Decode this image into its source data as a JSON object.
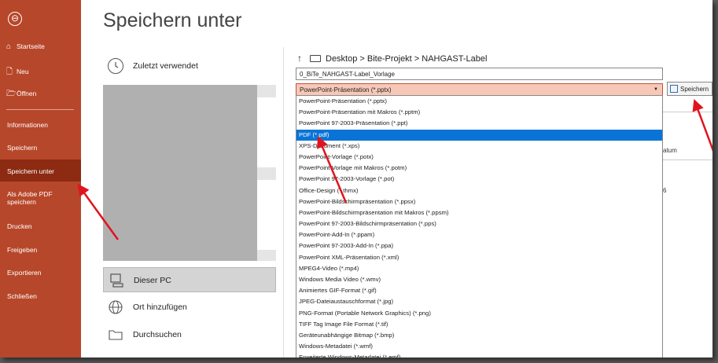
{
  "sidebar": {
    "back_symbol": "⊖",
    "items": [
      {
        "label": "Startseite",
        "icon": "home-icon"
      },
      {
        "label": "Neu",
        "icon": "new-document-icon"
      },
      {
        "label": "Öffnen",
        "icon": "open-folder-icon"
      },
      {
        "label": "Informationen"
      },
      {
        "label": "Speichern"
      },
      {
        "label": "Speichern unter"
      },
      {
        "label": "Als Adobe PDF speichern"
      },
      {
        "label": "Drucken"
      },
      {
        "label": "Freigeben"
      },
      {
        "label": "Exportieren"
      },
      {
        "label": "Schließen"
      }
    ]
  },
  "page_title": "Speichern unter",
  "locations": {
    "recent": "Zuletzt verwendet",
    "this_pc": "Dieser PC",
    "add_place": "Ort hinzufügen",
    "browse": "Durchsuchen"
  },
  "path": {
    "text": "Desktop > Bite-Projekt > NAHGAST-Label"
  },
  "filename": "0_BiTe_NAHGAST-Label_Vorlage",
  "filetype_selected": "PowerPoint-Präsentation (*.pptx)",
  "save_button": "Speichern",
  "dropdown_options": [
    "PowerPoint-Präsentation (*.pptx)",
    "PowerPoint-Präsentation mit Makros (*.pptm)",
    "PowerPoint 97-2003-Präsentation (*.ppt)",
    "PDF (*.pdf)",
    "XPS-Dokument (*.xps)",
    "PowerPoint-Vorlage (*.potx)",
    "PowerPoint-Vorlage mit Makros (*.potm)",
    "PowerPoint 97-2003-Vorlage (*.pot)",
    "Office-Design (*.thmx)",
    "PowerPoint-Bildschirmpräsentation (*.ppsx)",
    "PowerPoint-Bildschirmpräsentation mit Makros (*.ppsm)",
    "PowerPoint 97-2003-Bildschirmpräsentation (*.pps)",
    "PowerPoint-Add-In (*.ppam)",
    "PowerPoint 97-2003-Add-In (*.ppa)",
    "PowerPoint XML-Präsentation (*.xml)",
    "MPEG4-Video (*.mp4)",
    "Windows Media Video (*.wmv)",
    "Animiertes GIF-Format (*.gif)",
    "JPEG-Dateiaustauschformat (*.jpg)",
    "PNG-Format (Portable Network Graphics) (*.png)",
    "TIFF Tag Image File Format (*.tif)",
    "Geräteunabhängige Bitmap (*.bmp)",
    "Windows-Metadatei (*.wmf)",
    "Erweiterte Windows-Metadatei (*.emf)"
  ],
  "highlighted_option_index": 3,
  "side_peek": {
    "col_label": "atum",
    "value": "6"
  },
  "colors": {
    "sidebar": "#b7472a",
    "sidebar_active": "#8c2a12",
    "highlight": "#0a74d6",
    "filetype_bg": "#f7c8b8",
    "arrow": "#e0141e"
  }
}
